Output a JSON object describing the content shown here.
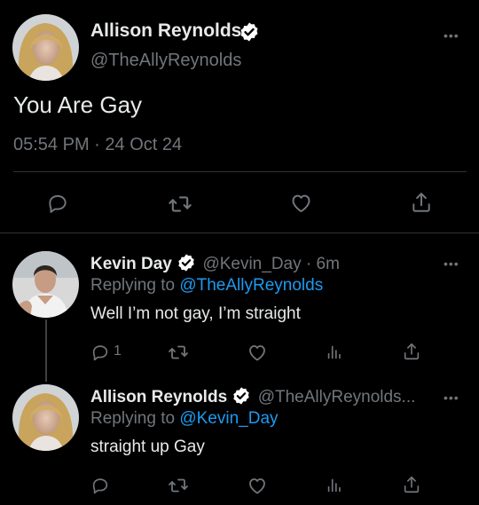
{
  "main_tweet": {
    "author_name": "Allison Reynolds",
    "handle": "@TheAllyReynolds",
    "text": "You Are Gay",
    "time": "05:54 PM",
    "separator": "·",
    "date": "24 Oct 24"
  },
  "reply_1": {
    "author_name": "Kevin Day",
    "handle": "@Kevin_Day",
    "separator": "·",
    "time_ago": "6m",
    "replying_label": "Replying to",
    "replying_to": "@TheAllyReynolds",
    "text": "Well I’m not gay, I’m straight",
    "reply_count": "1"
  },
  "reply_2": {
    "author_name": "Allison Reynolds",
    "handle": "@TheAllyReynolds...",
    "replying_label": "Replying to",
    "replying_to": "@Kevin_Day",
    "text": "straight up Gay"
  },
  "icons": {
    "more": "more-options-icon",
    "reply": "reply-icon",
    "retweet": "retweet-icon",
    "like": "like-icon",
    "share": "share-icon",
    "views": "views-icon",
    "verified": "verified-badge-icon"
  },
  "colors": {
    "background": "#000000",
    "text": "#e7e9ea",
    "muted": "#71767b",
    "link": "#1d9bf0",
    "divider": "#2f3336"
  },
  "more_glyph": "•••"
}
